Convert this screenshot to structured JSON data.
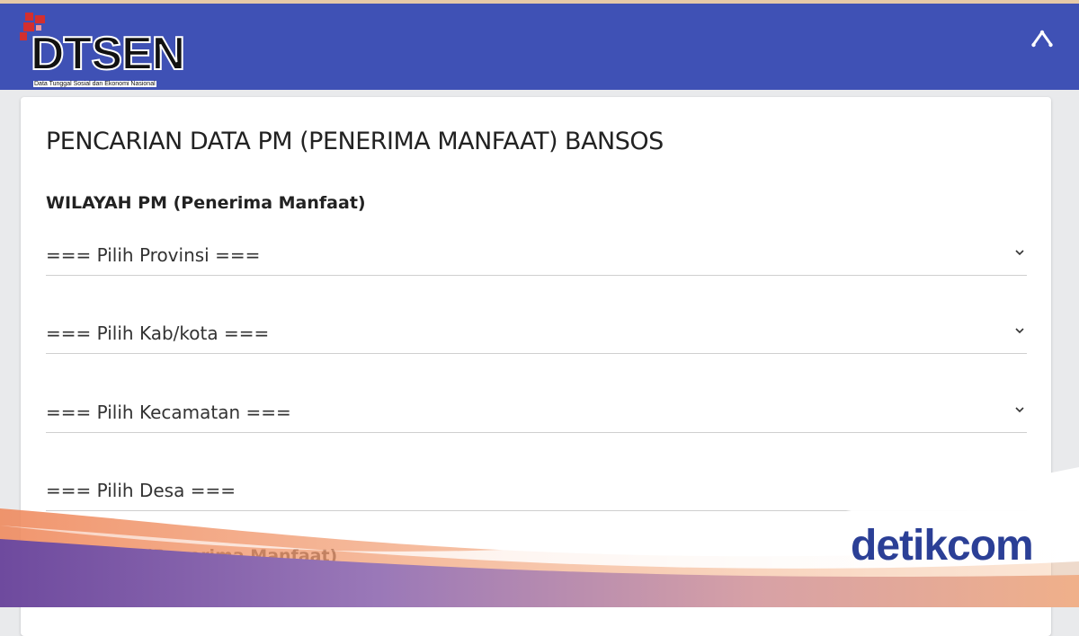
{
  "header": {
    "logo_text": "DTSEN",
    "logo_subtitle": "Data Tunggal Sosial dan Ekonomi Nasional",
    "logo_block_color": "#d32f2f",
    "background_color": "#3f51b5",
    "right_icon": "caret-up-icon"
  },
  "main": {
    "title": "PENCARIAN DATA PM (PENERIMA MANFAAT) BANSOS",
    "section_wilayah": "WILAYAH PM (Penerima Manfaat)",
    "selects": [
      {
        "label": "=== Pilih Provinsi ==="
      },
      {
        "label": "=== Pilih Kab/kota ==="
      },
      {
        "label": "=== Pilih Kecamatan ==="
      },
      {
        "label": "=== Pilih Desa ==="
      }
    ],
    "section_nama": "NAMA PM (Penerima Manfaat)"
  },
  "watermark": {
    "text": "detikcom",
    "color": "#2b3f96"
  }
}
